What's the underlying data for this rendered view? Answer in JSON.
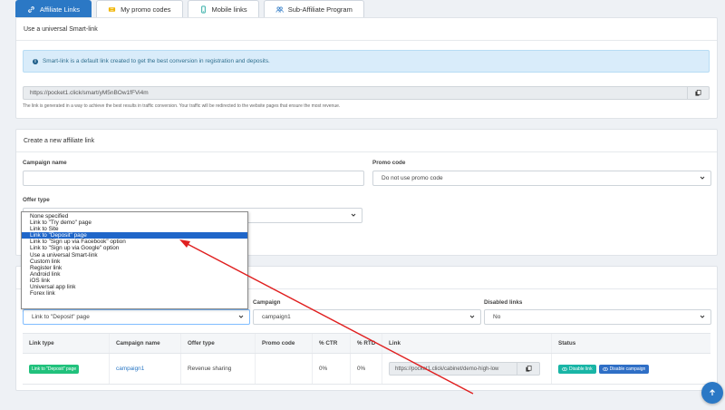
{
  "tabs": [
    {
      "label": "Affiliate Links",
      "icon": "link-icon"
    },
    {
      "label": "My promo codes",
      "icon": "ticket-icon"
    },
    {
      "label": "Mobile links",
      "icon": "mobile-icon"
    },
    {
      "label": "Sub-Affiliate Program",
      "icon": "users-icon"
    }
  ],
  "smartlink": {
    "header": "Use a universal Smart-link",
    "info": "Smart-link is a default link created to get the best conversion in registration and deposits.",
    "url": "https://pocket1.click/smart/yM5nBOw1fFVi4m",
    "help": "The link is generated in a way to achieve the best results in traffic conversion. Your traffic will be redirected to the website pages that ensure the most revenue."
  },
  "create": {
    "header": "Create a new affiliate link",
    "campaign_label": "Campaign name",
    "campaign_value": "",
    "promo_label": "Promo code",
    "promo_value": "Do not use promo code",
    "offer_label": "Offer type"
  },
  "dropdown": {
    "options": [
      "None specified",
      "Link to \"Try demo\" page",
      "Link to Site",
      "Link to \"Deposit\" page",
      "Link to \"Sign up via Facebook\" option",
      "Link to \"Sign up via Google\" option",
      "Use a universal Smart-link",
      "Custom link",
      "Register link",
      "Android link",
      "iOS link",
      "Universal app link",
      "Forex link"
    ],
    "selected_index": 3
  },
  "filters": {
    "linktype_value": "Link to \"Deposit\" page",
    "campaign_label": "Campaign",
    "campaign_value": "campaign1",
    "disabled_label": "Disabled links",
    "disabled_value": "No"
  },
  "table": {
    "headers": [
      "Link type",
      "Campaign name",
      "Offer type",
      "Promo code",
      "% CTR",
      "% RTD",
      "Link",
      "Status"
    ],
    "row": {
      "link_type": "Link to \"Deposit\" page",
      "campaign": "campaign1",
      "offer": "Revenue sharing",
      "promo": "",
      "ctr": "0%",
      "rtd": "0%",
      "link": "https://pocket1.click/cabinet/demo-high-low",
      "disable_link": "Disable link",
      "disable_campaign": "Disable campaign"
    }
  },
  "colors": {
    "accent": "#2b78c5",
    "green_badge": "#21c17c",
    "annotation_arrow": "#e02020"
  }
}
